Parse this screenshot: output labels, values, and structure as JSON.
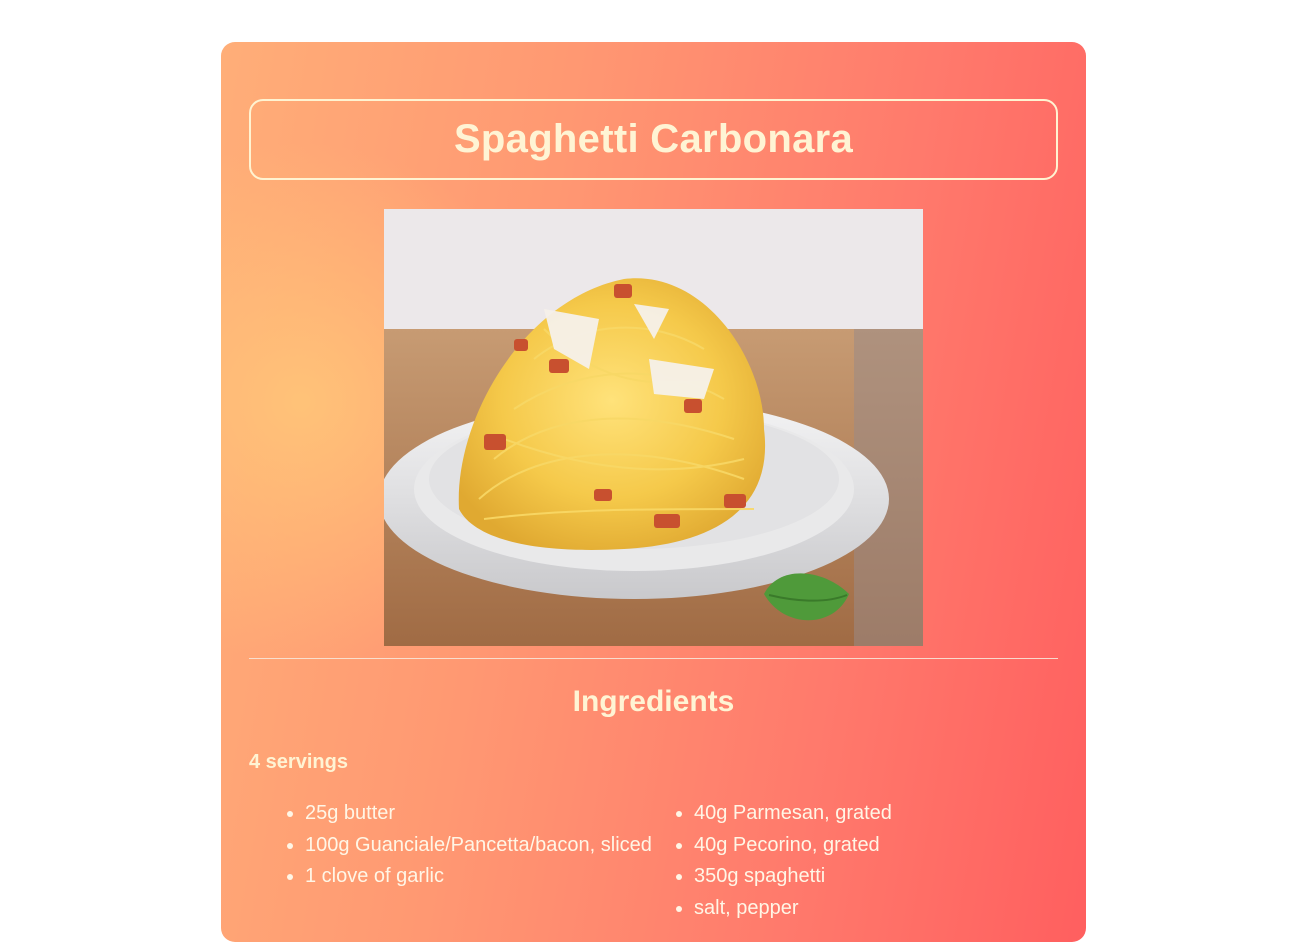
{
  "recipe": {
    "title": "Spaghetti Carbonara",
    "image_alt": "Plate of spaghetti carbonara on a wooden board",
    "ingredients_heading": "Ingredients",
    "servings": "4 servings",
    "ingredients_left": [
      "25g butter",
      "100g Guanciale/Pancetta/bacon, sliced",
      "1 clove of garlic"
    ],
    "ingredients_right": [
      "40g Parmesan, grated",
      "40g Pecorino, grated",
      "350g spaghetti",
      "salt, pepper"
    ]
  },
  "colors": {
    "card_gradient_start": "#ffae78",
    "card_gradient_end": "#ff5f5f",
    "text_cream": "#fff4d4"
  }
}
